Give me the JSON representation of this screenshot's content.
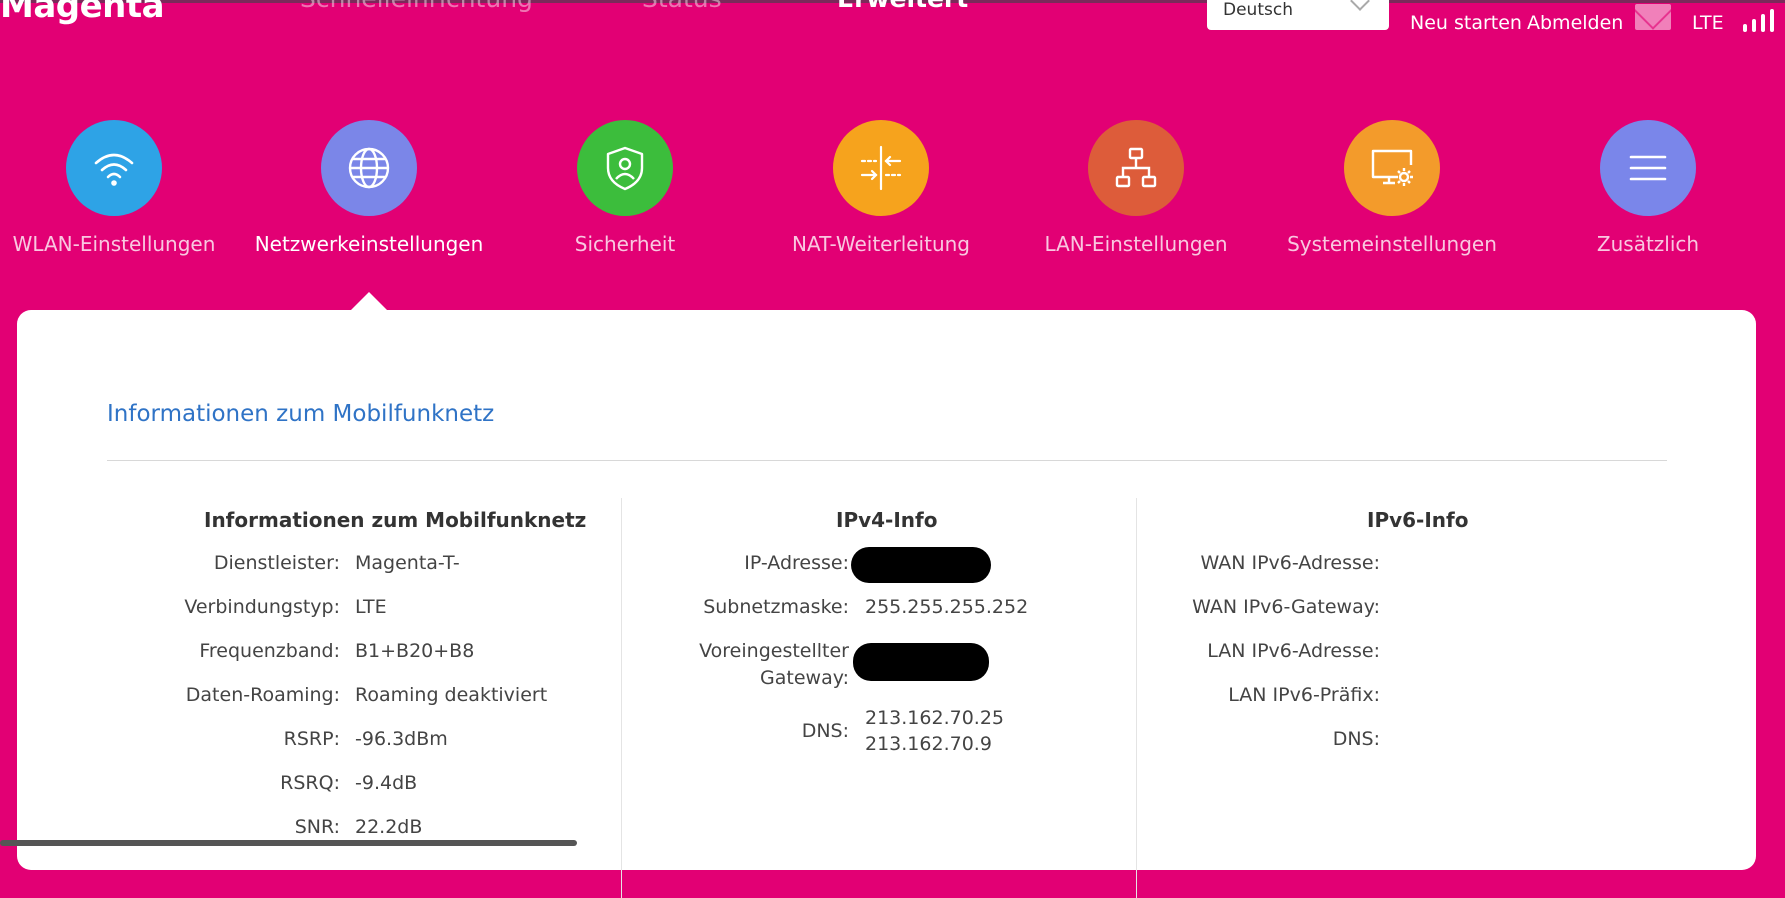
{
  "brand": {
    "logo": "Magenta"
  },
  "topnav": {
    "items": [
      "Schnelleinrichtung",
      "Status",
      "Erweitert"
    ],
    "active": "Erweitert"
  },
  "header": {
    "language": "Deutsch",
    "restart": "Neu starten",
    "logout": "Abmelden",
    "network_type": "LTE",
    "signal_level": "4/4"
  },
  "categories": [
    {
      "label": "WLAN-Einstellungen",
      "color": "#2ea3e6",
      "icon": "wifi-icon"
    },
    {
      "label": "Netzwerkeinstellungen",
      "color": "#7b86e8",
      "icon": "globe-icon"
    },
    {
      "label": "Sicherheit",
      "color": "#3cbd3c",
      "icon": "shield-user-icon"
    },
    {
      "label": "NAT-Weiterleitung",
      "color": "#f6a31d",
      "icon": "nat-arrows-icon"
    },
    {
      "label": "LAN-Einstellungen",
      "color": "#dd5c3a",
      "icon": "network-tree-icon"
    },
    {
      "label": "Systemeinstellungen",
      "color": "#f39b2b",
      "icon": "monitor-gear-icon"
    },
    {
      "label": "Zusätzlich",
      "color": "#7a86ea",
      "icon": "menu-icon"
    }
  ],
  "active_category": "Netzwerkeinstellungen",
  "section": {
    "title": "Informationen zum Mobilfunknetz"
  },
  "mobile": {
    "title": "Informationen zum Mobilfunknetz",
    "rows": [
      {
        "k": "Dienstleister:",
        "v": "Magenta-T-"
      },
      {
        "k": "Verbindungstyp:",
        "v": "LTE"
      },
      {
        "k": "Frequenzband:",
        "v": "B1+B20+B8"
      },
      {
        "k": "Daten-Roaming:",
        "v": "Roaming deaktiviert"
      },
      {
        "k": "RSRP:",
        "v": "-96.3dBm"
      },
      {
        "k": "RSRQ:",
        "v": "-9.4dB"
      },
      {
        "k": "SNR:",
        "v": "22.2dB"
      }
    ]
  },
  "ipv4": {
    "title": "IPv4-Info",
    "ip_label": "IP-Adresse:",
    "subnet_label": "Subnetzmaske:",
    "subnet_value": "255.255.255.252",
    "gateway_label_1": "Voreingestellter",
    "gateway_label_2": "Gateway:",
    "dns_label": "DNS:",
    "dns_1": "213.162.70.25",
    "dns_2": "213.162.70.9"
  },
  "ipv6": {
    "title": "IPv6-Info",
    "rows": [
      {
        "k": "WAN IPv6-Adresse:",
        "v": ""
      },
      {
        "k": "WAN IPv6-Gateway:",
        "v": ""
      },
      {
        "k": "LAN IPv6-Adresse:",
        "v": ""
      },
      {
        "k": "LAN IPv6-Präfix:",
        "v": ""
      },
      {
        "k": "DNS:",
        "v": ""
      }
    ]
  }
}
